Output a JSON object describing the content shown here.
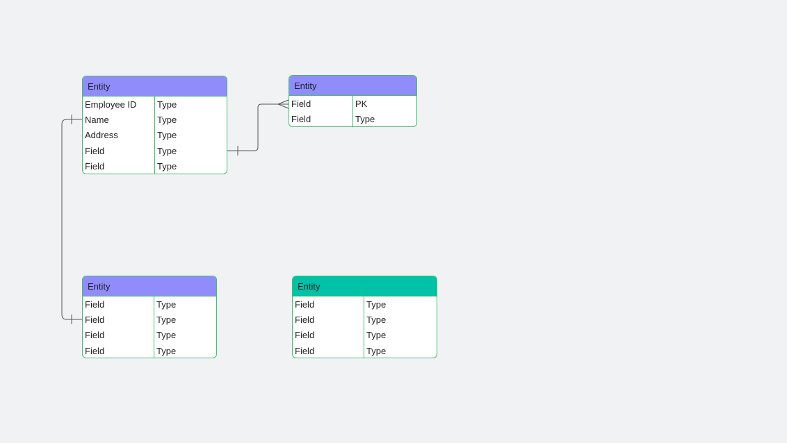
{
  "entities": {
    "employee": {
      "title": "Entity",
      "rows": [
        {
          "name": "Employee ID",
          "type": "Type"
        },
        {
          "name": "Name",
          "type": "Type"
        },
        {
          "name": "Address",
          "type": "Type"
        },
        {
          "name": "Field",
          "type": "Type"
        },
        {
          "name": "Field",
          "type": "Type"
        }
      ]
    },
    "right_top": {
      "title": "Entity",
      "rows": [
        {
          "name": "Field",
          "type": "PK"
        },
        {
          "name": "Field",
          "type": "Type"
        }
      ]
    },
    "bottom_left": {
      "title": "Entity",
      "rows": [
        {
          "name": "Field",
          "type": "Type"
        },
        {
          "name": "Field",
          "type": "Type"
        },
        {
          "name": "Field",
          "type": "Type"
        },
        {
          "name": "Field",
          "type": "Type"
        }
      ]
    },
    "bottom_right": {
      "title": "Entity",
      "rows": [
        {
          "name": "Field",
          "type": "Type"
        },
        {
          "name": "Field",
          "type": "Type"
        },
        {
          "name": "Field",
          "type": "Type"
        },
        {
          "name": "Field",
          "type": "Type"
        }
      ]
    }
  },
  "colors": {
    "header_purple": "#908dfb",
    "header_teal": "#00c2a6",
    "border_green": "#3fbf6f",
    "connector": "#555555",
    "background": "#f0f2f4"
  },
  "relationships": [
    {
      "from": "employee.rows.3",
      "to": "right_top.rows.0",
      "from_end": "one",
      "to_end": "many"
    },
    {
      "from": "employee.rows.1",
      "to": "bottom_left.rows.1",
      "from_end": "one",
      "to_end": "one"
    }
  ]
}
